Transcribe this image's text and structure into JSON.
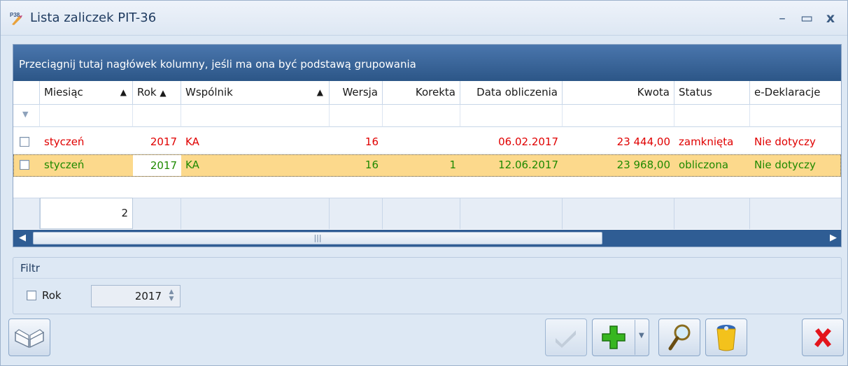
{
  "window": {
    "title": "Lista zaliczek PIT-36"
  },
  "grid": {
    "group_hint": "Przeciągnij tutaj nagłówek kolumny, jeśli ma ona być podstawą grupowania",
    "columns": [
      {
        "label": "Miesiąc",
        "sort": "▲"
      },
      {
        "label": "Rok",
        "sort": "▲"
      },
      {
        "label": "Wspólnik",
        "sort": "▲"
      },
      {
        "label": "Wersja"
      },
      {
        "label": "Korekta"
      },
      {
        "label": "Data obliczenia"
      },
      {
        "label": "Kwota"
      },
      {
        "label": "Status"
      },
      {
        "label": "e-Deklaracje"
      }
    ],
    "rows": [
      {
        "miesiac": "styczeń",
        "rok": "2017",
        "wspolnik": "KA",
        "wersja": "16",
        "korekta": "",
        "data": "06.02.2017",
        "kwota": "23 444,00",
        "status": "zamknięta",
        "edekl": "Nie dotyczy",
        "color": "#e00000",
        "selected": false
      },
      {
        "miesiac": "styczeń",
        "rok": "2017",
        "wspolnik": "KA",
        "wersja": "16",
        "korekta": "1",
        "data": "12.06.2017",
        "kwota": "23 968,00",
        "status": "obliczona",
        "edekl": "Nie dotyczy",
        "color": "#1e8a00",
        "selected": true
      }
    ],
    "row_count": "2",
    "scroll_grip": "|||"
  },
  "filter": {
    "header": "Filtr",
    "rok_label": "Rok",
    "rok_value": "2017"
  },
  "colors": {
    "group_bar": "#3a679d",
    "selected_row": "#fcd98c",
    "closed_status": "#e00000",
    "computed_status": "#1e8a00"
  }
}
